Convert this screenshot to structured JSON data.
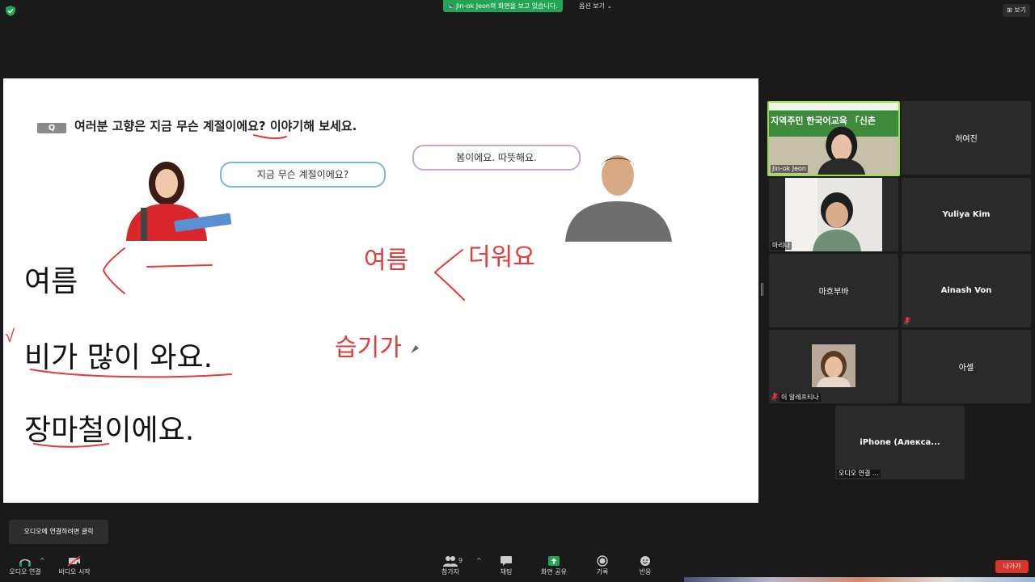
{
  "topbar": {
    "share_banner": "🔈Jin-ok Jeon의 화면을 보고 있습니다.",
    "view_options": "옵션 보기 ⌄",
    "view_button": "⊞ 보기"
  },
  "slide": {
    "question": "여러분 고향은 지금 무슨 계절이에요? 이야기해 보세요.",
    "bubble_woman": "지금 무슨 계절이에요?",
    "bubble_man": "봄이에요. 따뜻해요.",
    "line1": "여름",
    "line2": "비가 많이 와요.",
    "line3": "장마철이에요.",
    "hand_summer": "여름",
    "hand_hot": "더워요",
    "hand_humid": "습기가",
    "hand_check": "√"
  },
  "participants": [
    {
      "name": "Jin-ok Jeon",
      "banner": "지역주민 한국어교육 「신촌"
    },
    {
      "name": "허여진"
    },
    {
      "name": "마리나"
    },
    {
      "name": "Yuliya Kim"
    },
    {
      "name": "마흐부바"
    },
    {
      "name": "Ainash Von"
    },
    {
      "name": "이 알레프티나"
    },
    {
      "name": "아셀"
    },
    {
      "name": "iPhone  (Алекса...",
      "label": "오디오 연결 ..."
    }
  ],
  "toolbar": {
    "tooltip": "오디오에 연결하려면 클릭",
    "audio": "오디오 연결",
    "video": "비디오 시작",
    "participants": "참가자",
    "participants_count": "9",
    "chat": "채팅",
    "share": "화면 공유",
    "record": "기록",
    "reactions": "반응",
    "leave": "나가기"
  },
  "colors": {
    "accent_green": "#23a455",
    "ink_red": "#e23b3b",
    "leave_red": "#d9342b"
  }
}
